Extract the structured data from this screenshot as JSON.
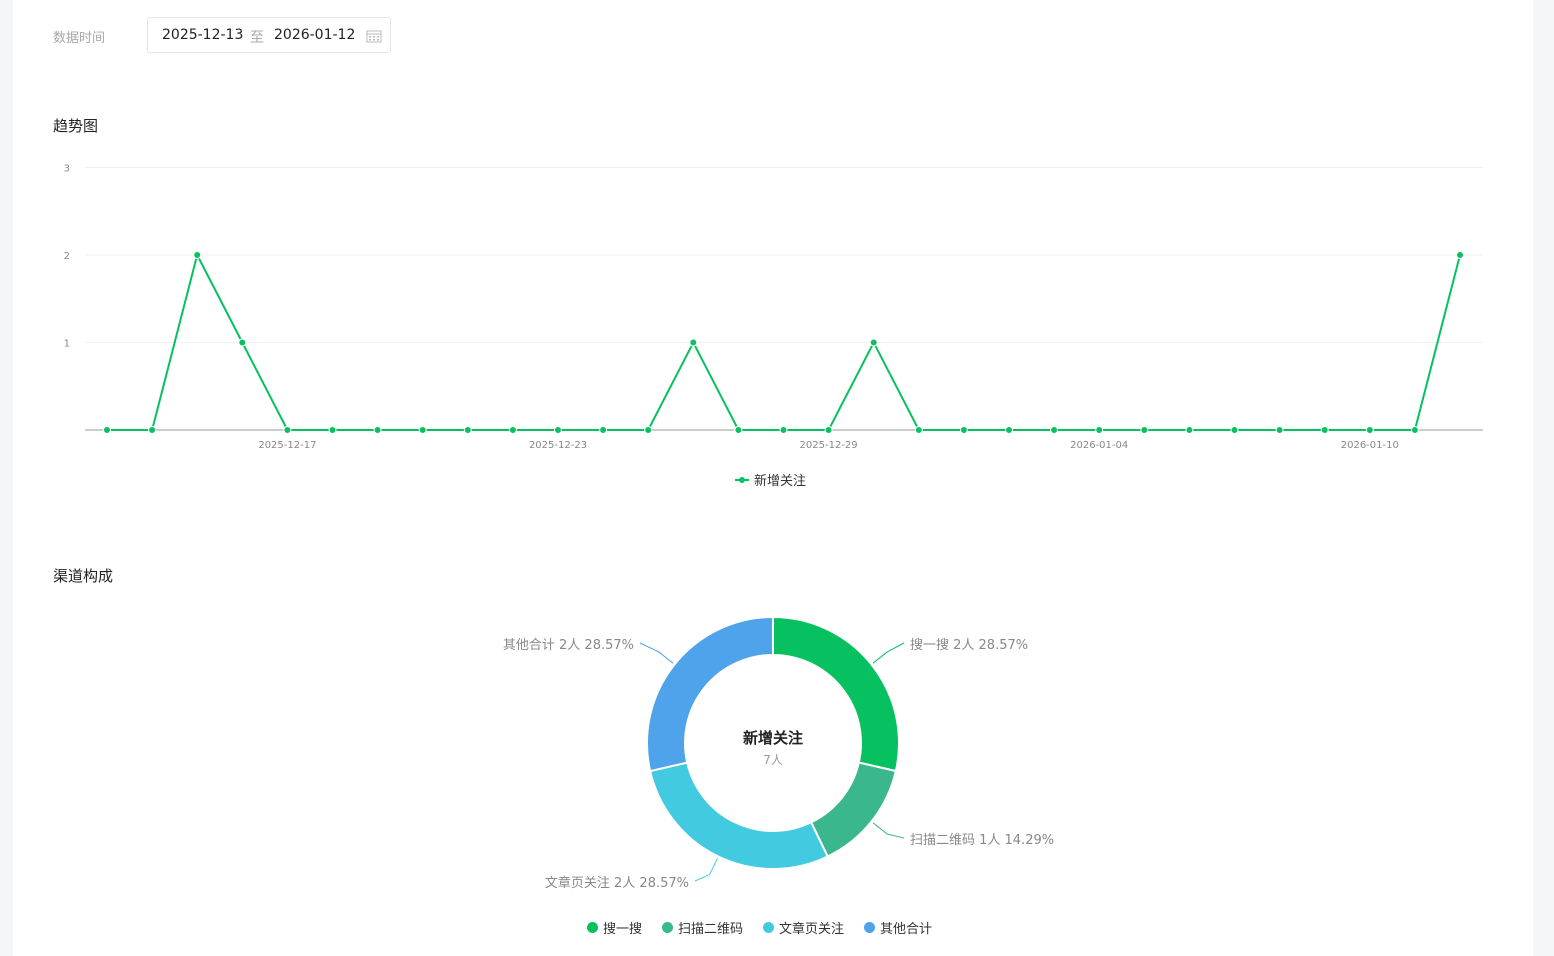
{
  "filter": {
    "label": "数据时间",
    "start": "2025-12-13",
    "sep": "至",
    "end": "2026-01-12",
    "icon": "calendar-icon"
  },
  "trend": {
    "title": "趋势图"
  },
  "channel": {
    "title": "渠道构成",
    "center_title": "新增关注",
    "center_value": "7人"
  },
  "chart_data": [
    {
      "type": "line",
      "title": "趋势图",
      "xlabel": "",
      "ylabel": "",
      "ylim": [
        0,
        3
      ],
      "yticks": [
        "1",
        "2",
        "3"
      ],
      "xtick_labels": [
        "2025-12-17",
        "2025-12-23",
        "2025-12-29",
        "2026-01-04",
        "2026-01-10"
      ],
      "xtick_index": [
        4,
        10,
        16,
        22,
        28
      ],
      "start_date": "2025-12-13",
      "end_date": "2026-01-12",
      "legend": "bottom",
      "grid": true,
      "series": [
        {
          "name": "新增关注",
          "color": "#07c160",
          "values": [
            0,
            0,
            2,
            1,
            0,
            0,
            0,
            0,
            0,
            0,
            0,
            0,
            0,
            1,
            0,
            0,
            0,
            1,
            0,
            0,
            0,
            0,
            0,
            0,
            0,
            0,
            0,
            0,
            0,
            0,
            2
          ]
        }
      ]
    },
    {
      "type": "pie",
      "title": "渠道构成",
      "legend": "bottom",
      "slices": [
        {
          "name": "搜一搜",
          "value": 2,
          "label": "搜一搜 2人 28.57%",
          "color": "#07c160"
        },
        {
          "name": "扫描二维码",
          "value": 1,
          "label": "扫描二维码 1人 14.29%",
          "color": "#3bb78d"
        },
        {
          "name": "文章页关注",
          "value": 2,
          "label": "文章页关注 2人 28.57%",
          "color": "#42cae0"
        },
        {
          "name": "其他合计",
          "value": 2,
          "label": "其他合计 2人 28.57%",
          "color": "#4ea3ea"
        }
      ]
    }
  ]
}
